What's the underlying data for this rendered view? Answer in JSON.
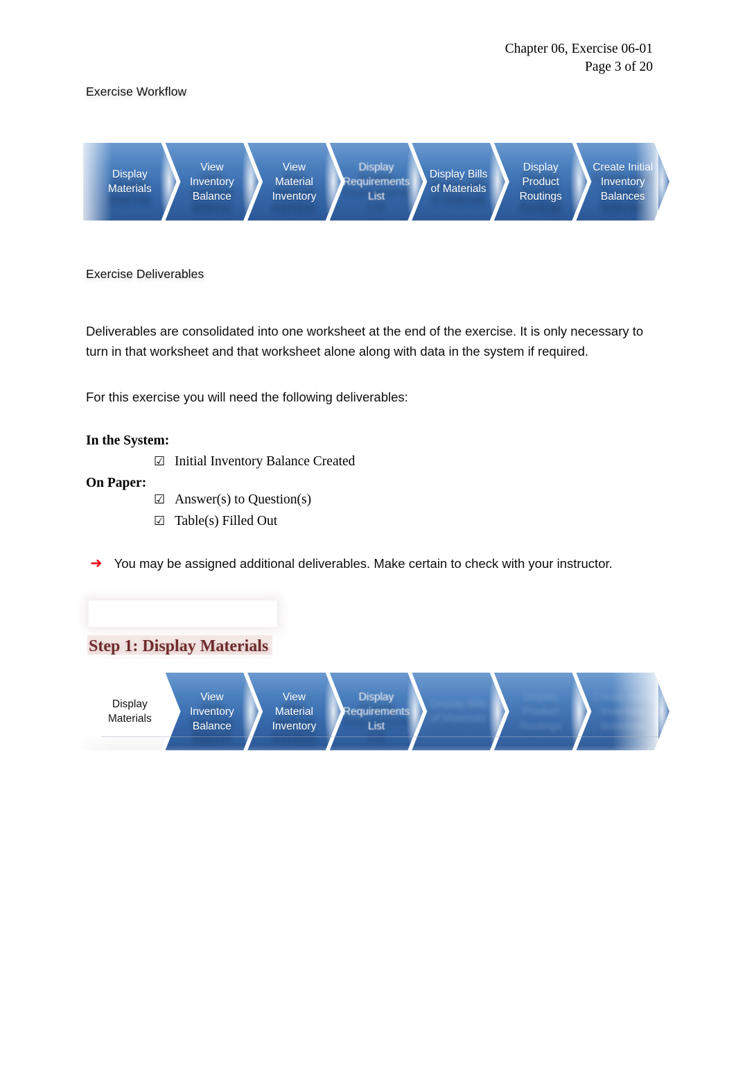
{
  "header": {
    "line1": "Chapter 06, Exercise 06-01",
    "line2": "Page 3 of 20"
  },
  "sections": {
    "workflow_heading": "Exercise Workflow",
    "deliverables_heading": "Exercise Deliverables"
  },
  "paragraphs": {
    "intro": "Deliverables are consolidated into one worksheet at the end of the exercise. It is only necessary to turn in that worksheet and that worksheet alone along with data in the system if required.",
    "needed": "For this exercise you will need the following deliverables:"
  },
  "deliverables": {
    "system_label": "In the System:",
    "paper_label": "On Paper:",
    "checkbox_glyph": "☑",
    "items": [
      {
        "text": "Initial Inventory Balance Created",
        "group": "In the System:"
      },
      {
        "text": "Answer(s) to Question(s)",
        "group": "On Paper:"
      },
      {
        "text": "Table(s) Filled Out",
        "group": "On Paper:"
      }
    ]
  },
  "note": {
    "arrow_glyph": "➜",
    "arrow_color": "#e8111c",
    "text": "You may be assigned additional deliverables. Make certain to check with your instructor."
  },
  "step": {
    "heading": "Step 1: Display Materials",
    "heading_color": "#6e2b2b",
    "active_index": 0
  },
  "workflow": {
    "accent_blue_light": "#6a99cf",
    "accent_blue_dark": "#2b5896",
    "steps": [
      {
        "label": "Display\nMaterials"
      },
      {
        "label": "View\nInventory\nBalance"
      },
      {
        "label": "View\nMaterial\nInventory"
      },
      {
        "label": "Display\nRequirements\nList"
      },
      {
        "label": "Display Bills\nof Materials"
      },
      {
        "label": "Display\nProduct\nRoutings"
      },
      {
        "label": "Create Initial\nInventory\nBalances"
      }
    ]
  }
}
